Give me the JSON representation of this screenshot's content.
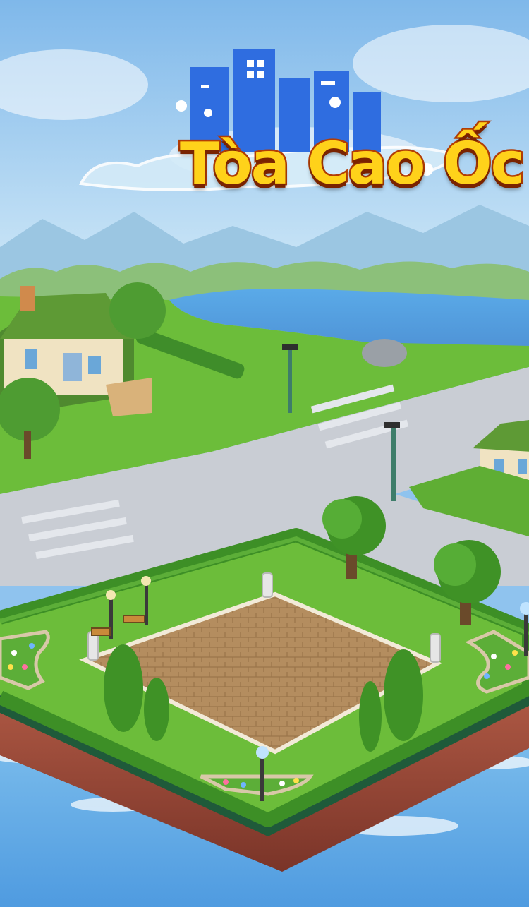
{
  "game": {
    "title": "Tòa Cao Ốc"
  },
  "colors": {
    "sky_top": "#7fb8ea",
    "sky_bottom": "#d4ebf8",
    "grass": "#6cbd3a",
    "road": "#c9cdd4",
    "paving": "#b48d5f",
    "water": "#63b9ee",
    "logo_fill": "#ffd21a",
    "logo_outline": "#b23d05",
    "city_silhouette": "#2f6de0"
  },
  "scene": {
    "objects": [
      "house-left",
      "house-right",
      "lake",
      "rock",
      "street-lamp",
      "tree",
      "cypress",
      "bench",
      "flower-bed",
      "bollard",
      "floating-island-platform"
    ]
  }
}
